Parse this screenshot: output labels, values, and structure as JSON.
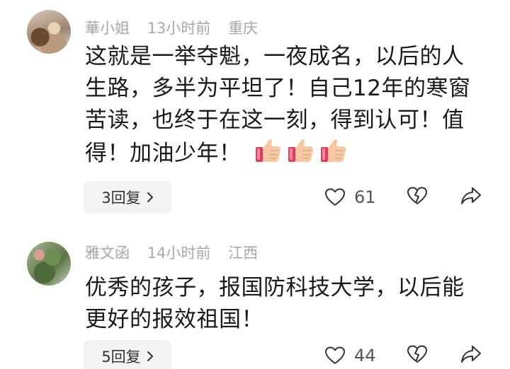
{
  "comments": [
    {
      "username": "華小姐",
      "time": "13小时前",
      "location": "重庆",
      "text": "这就是一举夺魁，一夜成名，以后的人生路，多半为平坦了！自己12年的寒窗苦读，也终于在这一刻，得到认可！值得！加油少年！",
      "emoji": [
        "thumbs-up-icon",
        "thumbs-up-icon",
        "thumbs-up-icon"
      ],
      "reply_label": "3回复",
      "likes": "61"
    },
    {
      "username": "雅文函",
      "time": "14小时前",
      "location": "江西",
      "text": "优秀的孩子，报国防科技大学，以后能更好的报效祖国！",
      "reply_label": "5回复",
      "likes": "44"
    }
  ],
  "colors": {
    "meta_text": "#a8a8a8",
    "body_text": "#1a1a1a",
    "reply_bg": "#f3f3f3",
    "thumb_skin": "#f6c9a4",
    "thumb_cuff": "#e5395b"
  }
}
